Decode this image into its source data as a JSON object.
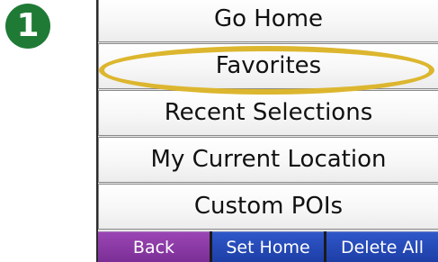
{
  "step": {
    "number": "1"
  },
  "menu": {
    "items": [
      {
        "label": "Go Home"
      },
      {
        "label": "Favorites",
        "highlighted": true
      },
      {
        "label": "Recent Selections"
      },
      {
        "label": "My Current Location"
      },
      {
        "label": "Custom POIs"
      }
    ]
  },
  "softkeys": {
    "back": "Back",
    "set_home": "Set Home",
    "delete_all": "Delete All"
  },
  "colors": {
    "step_badge": "#1f7a35",
    "highlight": "#dcb62e",
    "back_button": "#7b2f96",
    "blue_button": "#1d3ea6"
  }
}
